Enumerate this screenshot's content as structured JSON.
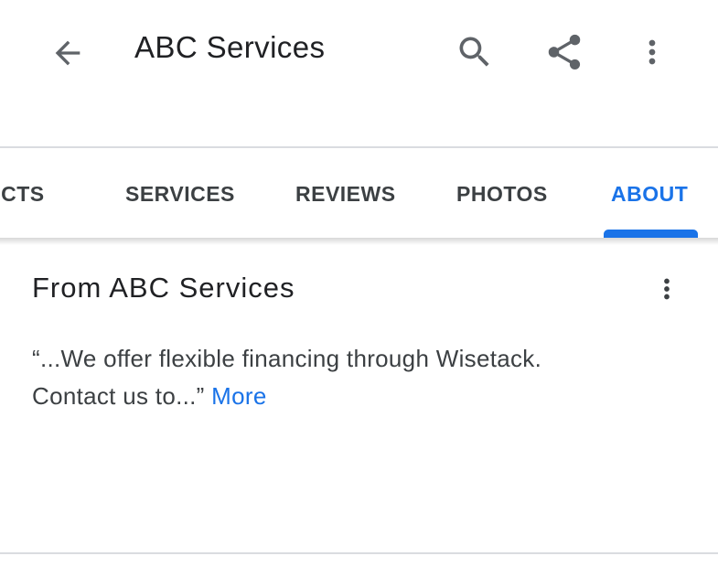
{
  "app_bar": {
    "title": "ABC Services",
    "icons": {
      "back": "arrow-back-icon",
      "search": "search-icon",
      "share": "share-icon",
      "more": "more-vert-icon"
    }
  },
  "tabs": [
    {
      "label": "PRODUCTS",
      "visible_label": "UCTS",
      "selected": false
    },
    {
      "label": "SERVICES",
      "visible_label": "SERVICES",
      "selected": false
    },
    {
      "label": "REVIEWS",
      "visible_label": "REVIEWS",
      "selected": false
    },
    {
      "label": "PHOTOS",
      "visible_label": "PHOTOS",
      "selected": false
    },
    {
      "label": "ABOUT",
      "visible_label": "ABOUT",
      "selected": true
    }
  ],
  "about": {
    "title": "From ABC Services",
    "description_line1": "“...We offer flexible financing through Wisetack.",
    "description_line2": "Contact us to...” ",
    "more_label": "More",
    "more_icon": "more-vert-icon"
  },
  "colors": {
    "accent": "#1a73e8",
    "text_primary": "#202124",
    "text_secondary": "#3c4043",
    "icon": "#5f6368",
    "divider": "#dadce0"
  }
}
